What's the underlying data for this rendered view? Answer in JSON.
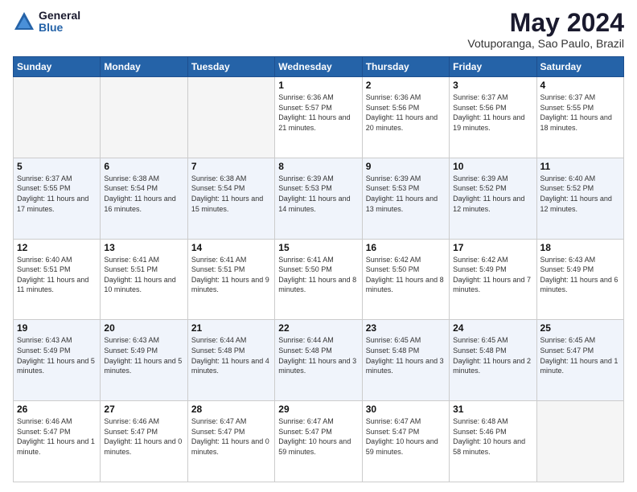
{
  "header": {
    "logo_general": "General",
    "logo_blue": "Blue",
    "month_title": "May 2024",
    "location": "Votuporanga, Sao Paulo, Brazil"
  },
  "weekdays": [
    "Sunday",
    "Monday",
    "Tuesday",
    "Wednesday",
    "Thursday",
    "Friday",
    "Saturday"
  ],
  "weeks": [
    [
      {
        "day": "",
        "empty": true
      },
      {
        "day": "",
        "empty": true
      },
      {
        "day": "",
        "empty": true
      },
      {
        "day": "1",
        "sunrise": "6:36 AM",
        "sunset": "5:57 PM",
        "daylight": "11 hours and 21 minutes."
      },
      {
        "day": "2",
        "sunrise": "6:36 AM",
        "sunset": "5:56 PM",
        "daylight": "11 hours and 20 minutes."
      },
      {
        "day": "3",
        "sunrise": "6:37 AM",
        "sunset": "5:56 PM",
        "daylight": "11 hours and 19 minutes."
      },
      {
        "day": "4",
        "sunrise": "6:37 AM",
        "sunset": "5:55 PM",
        "daylight": "11 hours and 18 minutes."
      }
    ],
    [
      {
        "day": "5",
        "sunrise": "6:37 AM",
        "sunset": "5:55 PM",
        "daylight": "11 hours and 17 minutes."
      },
      {
        "day": "6",
        "sunrise": "6:38 AM",
        "sunset": "5:54 PM",
        "daylight": "11 hours and 16 minutes."
      },
      {
        "day": "7",
        "sunrise": "6:38 AM",
        "sunset": "5:54 PM",
        "daylight": "11 hours and 15 minutes."
      },
      {
        "day": "8",
        "sunrise": "6:39 AM",
        "sunset": "5:53 PM",
        "daylight": "11 hours and 14 minutes."
      },
      {
        "day": "9",
        "sunrise": "6:39 AM",
        "sunset": "5:53 PM",
        "daylight": "11 hours and 13 minutes."
      },
      {
        "day": "10",
        "sunrise": "6:39 AM",
        "sunset": "5:52 PM",
        "daylight": "11 hours and 12 minutes."
      },
      {
        "day": "11",
        "sunrise": "6:40 AM",
        "sunset": "5:52 PM",
        "daylight": "11 hours and 12 minutes."
      }
    ],
    [
      {
        "day": "12",
        "sunrise": "6:40 AM",
        "sunset": "5:51 PM",
        "daylight": "11 hours and 11 minutes."
      },
      {
        "day": "13",
        "sunrise": "6:41 AM",
        "sunset": "5:51 PM",
        "daylight": "11 hours and 10 minutes."
      },
      {
        "day": "14",
        "sunrise": "6:41 AM",
        "sunset": "5:51 PM",
        "daylight": "11 hours and 9 minutes."
      },
      {
        "day": "15",
        "sunrise": "6:41 AM",
        "sunset": "5:50 PM",
        "daylight": "11 hours and 8 minutes."
      },
      {
        "day": "16",
        "sunrise": "6:42 AM",
        "sunset": "5:50 PM",
        "daylight": "11 hours and 8 minutes."
      },
      {
        "day": "17",
        "sunrise": "6:42 AM",
        "sunset": "5:49 PM",
        "daylight": "11 hours and 7 minutes."
      },
      {
        "day": "18",
        "sunrise": "6:43 AM",
        "sunset": "5:49 PM",
        "daylight": "11 hours and 6 minutes."
      }
    ],
    [
      {
        "day": "19",
        "sunrise": "6:43 AM",
        "sunset": "5:49 PM",
        "daylight": "11 hours and 5 minutes."
      },
      {
        "day": "20",
        "sunrise": "6:43 AM",
        "sunset": "5:49 PM",
        "daylight": "11 hours and 5 minutes."
      },
      {
        "day": "21",
        "sunrise": "6:44 AM",
        "sunset": "5:48 PM",
        "daylight": "11 hours and 4 minutes."
      },
      {
        "day": "22",
        "sunrise": "6:44 AM",
        "sunset": "5:48 PM",
        "daylight": "11 hours and 3 minutes."
      },
      {
        "day": "23",
        "sunrise": "6:45 AM",
        "sunset": "5:48 PM",
        "daylight": "11 hours and 3 minutes."
      },
      {
        "day": "24",
        "sunrise": "6:45 AM",
        "sunset": "5:48 PM",
        "daylight": "11 hours and 2 minutes."
      },
      {
        "day": "25",
        "sunrise": "6:45 AM",
        "sunset": "5:47 PM",
        "daylight": "11 hours and 1 minute."
      }
    ],
    [
      {
        "day": "26",
        "sunrise": "6:46 AM",
        "sunset": "5:47 PM",
        "daylight": "11 hours and 1 minute."
      },
      {
        "day": "27",
        "sunrise": "6:46 AM",
        "sunset": "5:47 PM",
        "daylight": "11 hours and 0 minutes."
      },
      {
        "day": "28",
        "sunrise": "6:47 AM",
        "sunset": "5:47 PM",
        "daylight": "11 hours and 0 minutes."
      },
      {
        "day": "29",
        "sunrise": "6:47 AM",
        "sunset": "5:47 PM",
        "daylight": "10 hours and 59 minutes."
      },
      {
        "day": "30",
        "sunrise": "6:47 AM",
        "sunset": "5:47 PM",
        "daylight": "10 hours and 59 minutes."
      },
      {
        "day": "31",
        "sunrise": "6:48 AM",
        "sunset": "5:46 PM",
        "daylight": "10 hours and 58 minutes."
      },
      {
        "day": "",
        "empty": true
      }
    ]
  ]
}
